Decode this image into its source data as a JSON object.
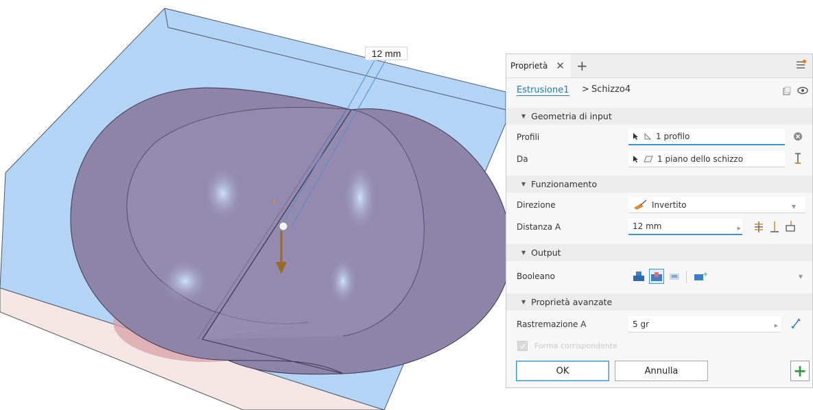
{
  "viewport": {
    "dimension_label": "12 mm",
    "colors": {
      "plane": "#b3d4f5",
      "body": "#8e84a8",
      "arrow": "#9a6a2a"
    }
  },
  "panel": {
    "tab": {
      "label": "Proprietà",
      "close_icon": "close-icon",
      "add_icon": "plus-icon"
    },
    "breadcrumb": {
      "link": "Estrusione1",
      "separator": ">",
      "current": "Schizzo4"
    },
    "sections": {
      "input_geometry": {
        "title": "Geometria di input",
        "profiles_label": "Profili",
        "profiles_value": "1 profilo",
        "from_label": "Da",
        "from_value": "1 piano dello schizzo"
      },
      "behavior": {
        "title": "Funzionamento",
        "direction_label": "Direzione",
        "direction_value": "Invertito",
        "distance_label": "Distanza A",
        "distance_value": "12 mm"
      },
      "output": {
        "title": "Output",
        "boolean_label": "Booleano"
      },
      "advanced": {
        "title": "Proprietà avanzate",
        "taper_label": "Rastremazione A",
        "taper_value": "5 gr",
        "match_shape_label": "Forma corrispondente"
      }
    },
    "buttons": {
      "ok": "OK",
      "cancel": "Annulla",
      "add": "+"
    },
    "accent_color": "#3a94cf",
    "link_color": "#1c7ab8"
  }
}
